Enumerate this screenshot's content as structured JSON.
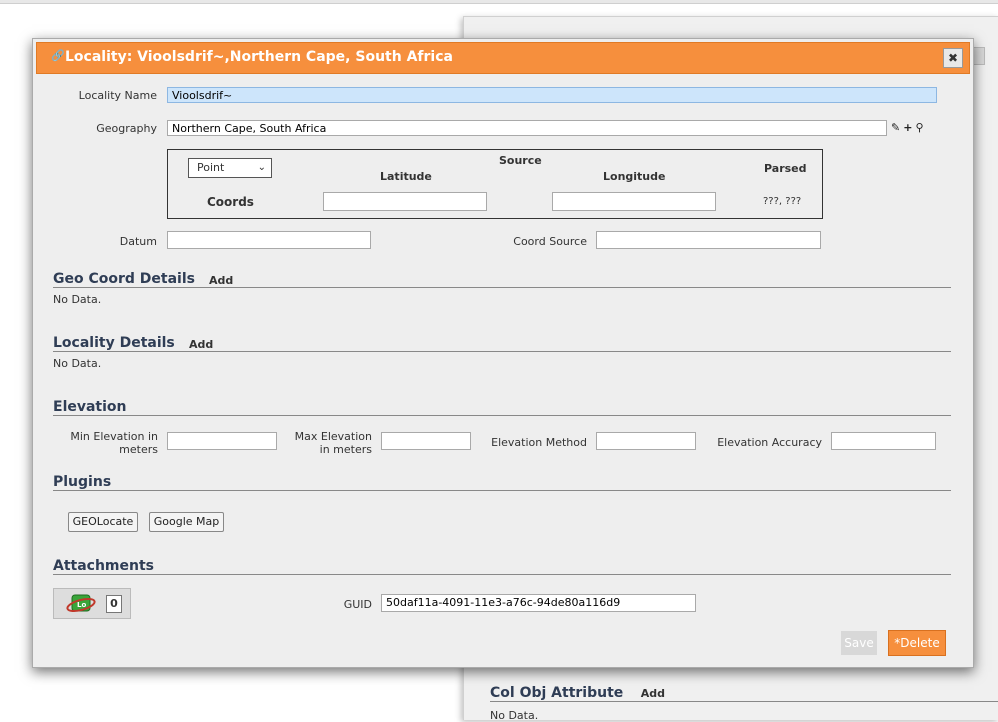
{
  "background": {
    "section_title": "Col Obj Attribute",
    "section_add": "Add",
    "no_data": "No Data."
  },
  "dialog": {
    "title": "Locality: Vioolsdrif~,Northern Cape, South Africa",
    "close_label": "✖",
    "locality_name_label": "Locality Name",
    "locality_name_value": "Vioolsdrif~",
    "geography_label": "Geography",
    "geography_value": "Northern Cape, South Africa",
    "coords": {
      "type_selected": "Point",
      "source_label": "Source",
      "latitude_label": "Latitude",
      "longitude_label": "Longitude",
      "parsed_label": "Parsed",
      "coords_label": "Coords",
      "latitude_value": "",
      "longitude_value": "",
      "parsed_value": "???, ???"
    },
    "datum_label": "Datum",
    "datum_value": "",
    "coord_source_label": "Coord Source",
    "coord_source_value": "",
    "geo_coord_details": {
      "title": "Geo Coord Details",
      "add": "Add",
      "no_data": "No Data."
    },
    "locality_details": {
      "title": "Locality Details",
      "add": "Add",
      "no_data": "No Data."
    },
    "elevation": {
      "title": "Elevation",
      "min_label_1": "Min Elevation in",
      "min_label_2": "meters",
      "max_label_1": "Max Elevation",
      "max_label_2": "in meters",
      "method_label": "Elevation Method",
      "accuracy_label": "Elevation Accuracy",
      "min_value": "",
      "max_value": "",
      "method_value": "",
      "accuracy_value": ""
    },
    "plugins": {
      "title": "Plugins",
      "geolocate_label": "GEOLocate",
      "google_map_label": "Google Map"
    },
    "attachments": {
      "title": "Attachments",
      "count": "0"
    },
    "guid_label": "GUID",
    "guid_value": "50daf11a-4091-11e3-a76c-94de80a116d9",
    "save_label": "Save",
    "delete_label": "*Delete"
  },
  "colors": {
    "accent": "#f68f3d",
    "section_title": "#2f3d55",
    "focus_input": "#cde5fb"
  }
}
